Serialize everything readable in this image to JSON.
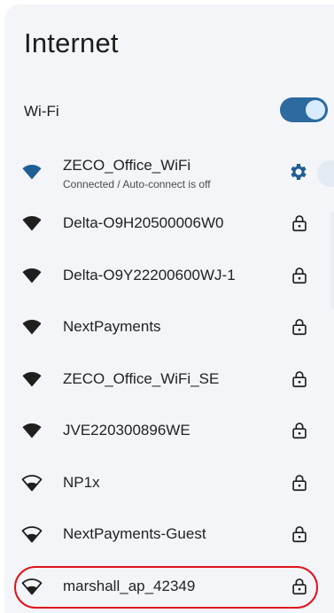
{
  "header": {
    "title": "Internet"
  },
  "wifi": {
    "label": "Wi-Fi",
    "enabled": true
  },
  "connected": {
    "ssid": "ZECO_Office_WiFi",
    "status": "Connected / Auto-connect is off",
    "icon": "wifi-signal-icon",
    "action_icon": "gear-icon"
  },
  "networks": [
    {
      "ssid": "Delta-O9H20500006W0",
      "secured": true
    },
    {
      "ssid": "Delta-O9Y22200600WJ-1",
      "secured": true
    },
    {
      "ssid": "NextPayments",
      "secured": true
    },
    {
      "ssid": "ZECO_Office_WiFi_SE",
      "secured": true
    },
    {
      "ssid": "JVE220300896WE",
      "secured": true
    },
    {
      "ssid": "NP1x",
      "secured": true
    },
    {
      "ssid": "NextPayments-Guest",
      "secured": true
    },
    {
      "ssid": "marshall_ap_42349",
      "secured": true,
      "highlighted": true
    }
  ],
  "colors": {
    "accent": "#2c6aa0",
    "connected_icon": "#1e5f94",
    "highlight": "#e0141b",
    "panel": "#f3f5f8"
  }
}
